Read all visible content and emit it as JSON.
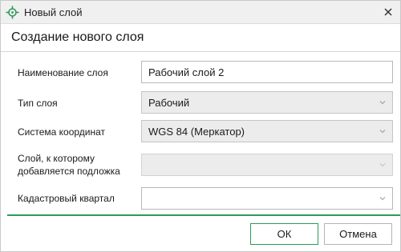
{
  "window": {
    "title": "Новый слой",
    "icon": "layer-target-icon",
    "close_icon": "close-icon"
  },
  "header": {
    "title": "Создание нового слоя"
  },
  "form": {
    "layer_name": {
      "label": "Наименование слоя",
      "value": "Рабочий слой 2"
    },
    "layer_type": {
      "label": "Тип слоя",
      "value": "Рабочий"
    },
    "coord_system": {
      "label": "Система координат",
      "value": "WGS 84 (Меркатор)"
    },
    "base_layer": {
      "label_line1": "Слой, к которому",
      "label_line2": "добавляется подложка",
      "value": ""
    },
    "cadastral": {
      "label": "Кадастровый квартал",
      "value": ""
    }
  },
  "buttons": {
    "ok": "ОК",
    "cancel": "Отмена"
  },
  "colors": {
    "accent": "#2e9a5a",
    "icon": "#2e9a5a"
  }
}
